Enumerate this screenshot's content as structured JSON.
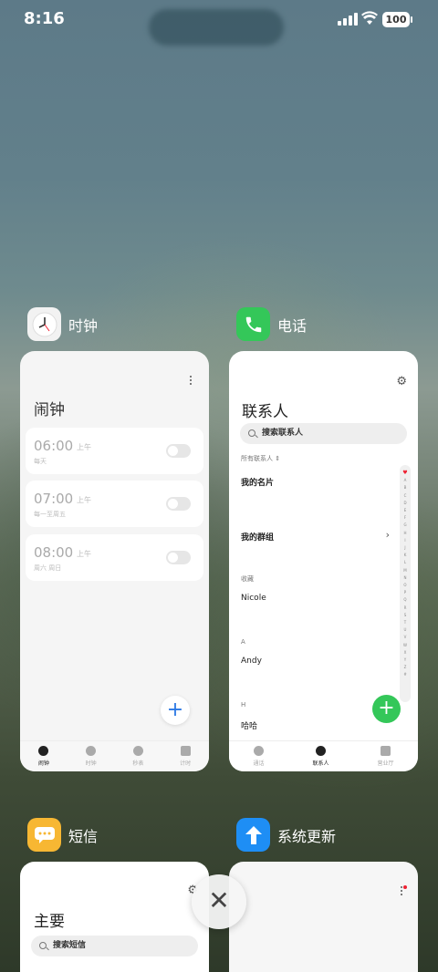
{
  "status": {
    "time": "8:16",
    "battery": "100"
  },
  "apps": {
    "clock": {
      "name": "时钟",
      "title": "闹钟",
      "alarms": [
        {
          "time": "06:00",
          "ampm": "上午",
          "repeat": "每天"
        },
        {
          "time": "07:00",
          "ampm": "上午",
          "repeat": "每一至周五"
        },
        {
          "time": "08:00",
          "ampm": "上午",
          "repeat": "周六 周日"
        }
      ],
      "tabs": [
        "闹钟",
        "时钟",
        "秒表",
        "计时"
      ],
      "active_tab": "闹钟"
    },
    "contacts": {
      "name": "电话",
      "title": "联系人",
      "search_placeholder": "搜索联系人",
      "filter": "所有联系人 ⇕",
      "my_card": "我的名片",
      "my_groups": "我的群组",
      "favorites_label": "收藏",
      "favorite": "Nicole",
      "section_a": "A",
      "contact_a": "Andy",
      "section_h": "H",
      "contact_h": "哈哈",
      "index": [
        "♥",
        "A",
        "B",
        "C",
        "D",
        "E",
        "F",
        "G",
        "H",
        "I",
        "J",
        "K",
        "L",
        "M",
        "N",
        "O",
        "P",
        "Q",
        "R",
        "S",
        "T",
        "U",
        "V",
        "W",
        "X",
        "Y",
        "Z",
        "#"
      ],
      "tabs": [
        "通话",
        "联系人",
        "营业厅"
      ],
      "active_tab": "联系人"
    },
    "messages": {
      "name": "短信",
      "title": "主要",
      "search_placeholder": "搜索短信"
    },
    "update": {
      "name": "系统更新"
    }
  },
  "colors": {
    "phone_green": "#34c759",
    "message_yellow": "#f7b733",
    "update_blue": "#1e8ef5",
    "clock_accent": "#2b78e4"
  }
}
